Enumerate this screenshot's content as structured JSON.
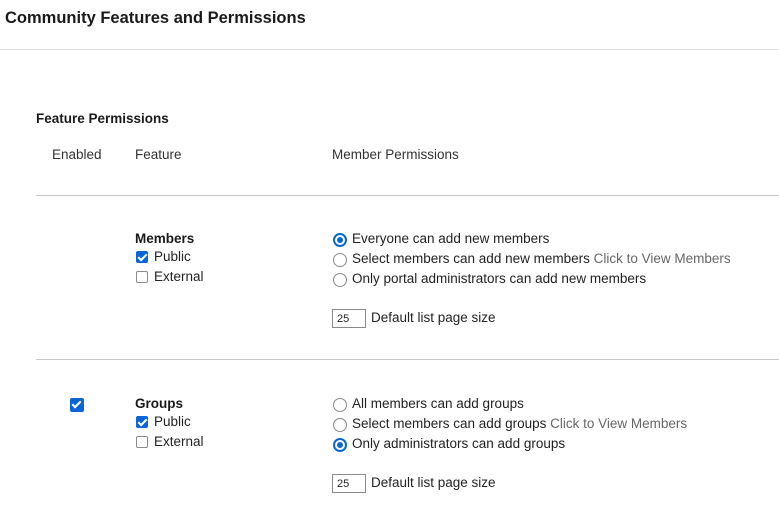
{
  "page": {
    "title": "Community Features and Permissions"
  },
  "section": {
    "title": "Feature Permissions"
  },
  "columns": {
    "enabled": "Enabled",
    "feature": "Feature",
    "permissions": "Member Permissions"
  },
  "features": [
    {
      "name": "Members",
      "enabled": null,
      "public_label": "Public",
      "public_checked": true,
      "external_label": "External",
      "external_checked": false,
      "options": [
        {
          "label": "Everyone can add new members",
          "link": "",
          "selected": true
        },
        {
          "label": "Select members can add new members",
          "link": "Click to View Members",
          "selected": false
        },
        {
          "label": "Only portal administrators can add new members",
          "link": "",
          "selected": false
        }
      ],
      "page_size": "25",
      "page_size_label": "Default list page size"
    },
    {
      "name": "Groups",
      "enabled": true,
      "public_label": "Public",
      "public_checked": true,
      "external_label": "External",
      "external_checked": false,
      "options": [
        {
          "label": "All members can add groups",
          "link": "",
          "selected": false
        },
        {
          "label": "Select members can add groups",
          "link": "Click to View Members",
          "selected": false
        },
        {
          "label": "Only administrators can add groups",
          "link": "",
          "selected": true
        }
      ],
      "page_size": "25",
      "page_size_label": "Default list page size"
    }
  ]
}
